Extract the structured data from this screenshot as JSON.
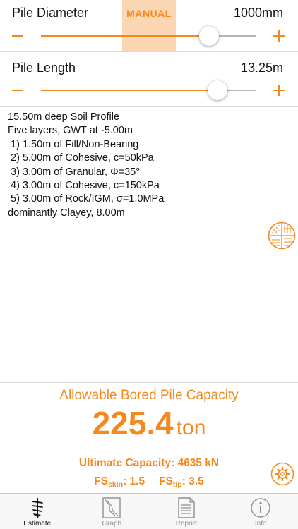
{
  "diameter": {
    "label": "Pile Diameter",
    "value": "1000mm",
    "mode_badge": "MANUAL",
    "slider_level": 0.78
  },
  "length": {
    "label": "Pile Length",
    "value": "13.25m",
    "slider_level": 0.82
  },
  "profile": {
    "lines": [
      "15.50m deep Soil Profile",
      "Five layers, GWT at -5.00m",
      " 1) 1.50m of Fill/Non-Bearing",
      " 2) 5.00m of Cohesive, c=50kPa",
      " 3) 3.00m of Granular, Φ=35°",
      " 4) 3.00m of Cohesive, c=150kPa",
      " 5) 3.00m of Rock/IGM, σ=1.0MPa",
      "dominantly Clayey, 8.00m"
    ]
  },
  "results": {
    "title": "Allowable Bored Pile Capacity",
    "capacity_value": "225.4",
    "capacity_unit": "ton",
    "ultimate_text": "Ultimate Capacity: 4635 kN",
    "fs_skin_label": "FS",
    "fs_skin_sub": "skin",
    "fs_skin_value": ": 1.5",
    "fs_tip_label": "FS",
    "fs_tip_sub": "tip",
    "fs_tip_value": ": 3.5"
  },
  "icons": {
    "soil_button": "soil-layers-icon",
    "settings_button": "gear-icon"
  },
  "tabs": [
    {
      "label": "Estimate",
      "icon": "auger-icon",
      "active": true
    },
    {
      "label": "Graph",
      "icon": "graph-icon",
      "active": false
    },
    {
      "label": "Report",
      "icon": "report-icon",
      "active": false
    },
    {
      "label": "Info",
      "icon": "info-icon",
      "active": false
    }
  ],
  "colors": {
    "accent": "#f4891f",
    "accent_light": "#fbd6b3",
    "track": "#b7b7b7",
    "tab_inactive": "#8e8e8e"
  }
}
